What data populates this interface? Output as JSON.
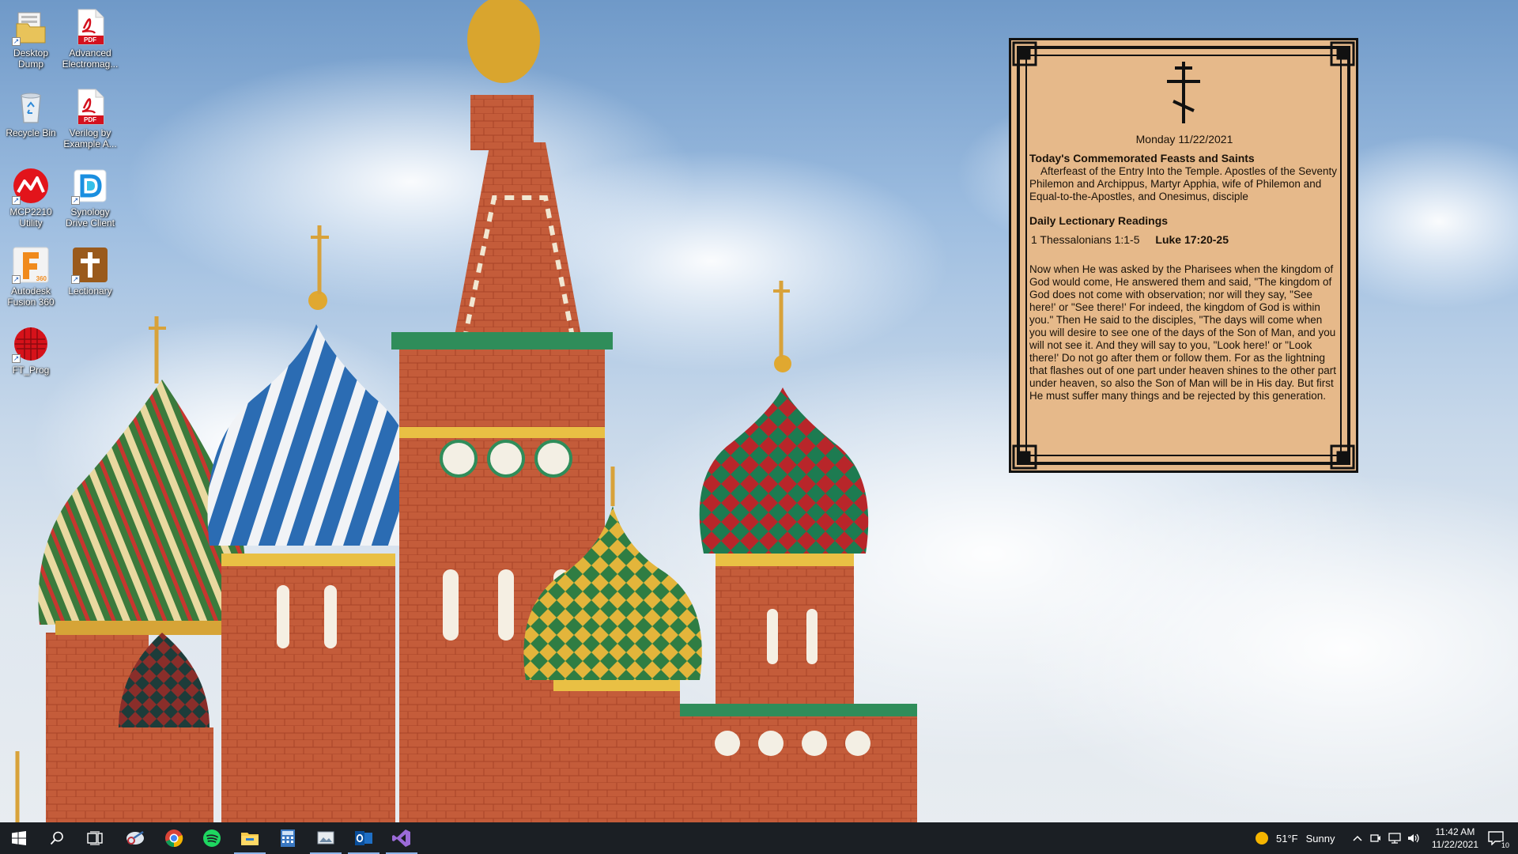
{
  "desktop": {
    "icons": [
      {
        "label": "Desktop Dump",
        "icon": "folder-icon"
      },
      {
        "label": "Advanced Electromag...",
        "icon": "pdf-icon"
      },
      {
        "label": "Recycle Bin",
        "icon": "recycle-bin-icon"
      },
      {
        "label": "Verilog by Example A...",
        "icon": "pdf-icon"
      },
      {
        "label": "MCP2210 Utility",
        "icon": "microchip-icon"
      },
      {
        "label": "Synology Drive Client",
        "icon": "synology-drive-icon"
      },
      {
        "label": "Autodesk Fusion 360",
        "icon": "fusion360-icon"
      },
      {
        "label": "Lectionary",
        "icon": "lectionary-icon"
      },
      {
        "label": "FT_Prog",
        "icon": "ftprog-icon"
      }
    ],
    "pdf_badge": "PDF",
    "fusion_badge": "360"
  },
  "widget": {
    "date": "Monday 11/22/2021",
    "feasts_heading": "Today's Commemorated Feasts and Saints",
    "feasts": "Afterfeast of the Entry Into the Temple. Apostles of the Seventy Philemon and Archippus, Martyr Apphia, wife of Philemon and Equal-to-the-Apostles, and Onesimus, disciple",
    "readings_heading": "Daily Lectionary Readings",
    "epistle": "1 Thessalonians 1:1-5",
    "gospel": "Luke 17:20-25",
    "text": "Now when He was asked by the Pharisees when the kingdom of God would come, He answered them and said, \"The kingdom of God does not come with observation; nor will they say, \"See here!' or \"See there!' For indeed, the kingdom of God is within you.\" Then He said to the disciples, \"The days will come when you will desire to see one of the days of the Son of Man, and you will not see it. And they will say to you, \"Look here!' or \"Look there!' Do not go after them or follow them. For as the lightning that flashes out of one part under heaven shines to the other part under heaven, so also the Son of Man will be in His day. But first He must suffer many things and be rejected by this generation."
  },
  "taskbar": {
    "apps": [
      "start-icon",
      "search-icon",
      "task-view-icon",
      "snipping-tool-icon",
      "chrome-icon",
      "spotify-icon",
      "file-explorer-icon",
      "calculator-icon",
      "photos-icon",
      "outlook-icon",
      "visual-studio-icon"
    ],
    "weather_temp": "51°F",
    "weather_cond": "Sunny",
    "time": "11:42 AM",
    "date": "11/22/2021",
    "notifications": "10"
  },
  "colors": {
    "widget_bg": "#e6b98a",
    "taskbar_bg": "#1b1f24"
  }
}
